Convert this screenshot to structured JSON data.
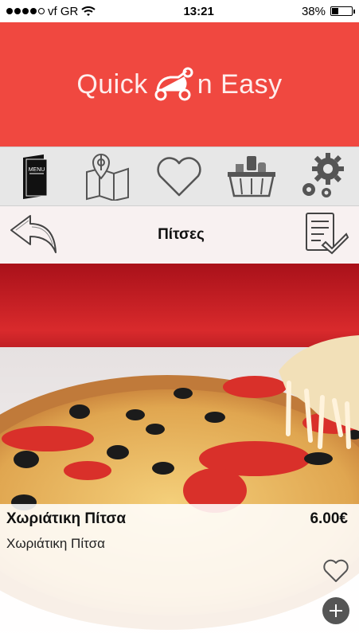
{
  "status_bar": {
    "carrier": "vf GR",
    "time": "13:21",
    "battery": "38%",
    "battery_level": 0.38
  },
  "header": {
    "brand_left": "Quick",
    "brand_right": "n Easy"
  },
  "nav": {
    "items": [
      {
        "name": "menu",
        "icon": "menu-book-icon",
        "label": "MENU"
      },
      {
        "name": "map",
        "icon": "map-icon"
      },
      {
        "name": "favorites",
        "icon": "heart-icon"
      },
      {
        "name": "basket",
        "icon": "basket-icon"
      },
      {
        "name": "settings",
        "icon": "gear-icon"
      }
    ]
  },
  "category": {
    "title": "Πίτσες"
  },
  "product": {
    "name": "Χωριάτικη Πίτσα",
    "description": "Χωριάτικη Πίτσα",
    "price": "6.00€"
  },
  "colors": {
    "header_bg": "#f04840",
    "nav_bg": "#e7e7e7",
    "title_bg": "#f8f1f1"
  }
}
